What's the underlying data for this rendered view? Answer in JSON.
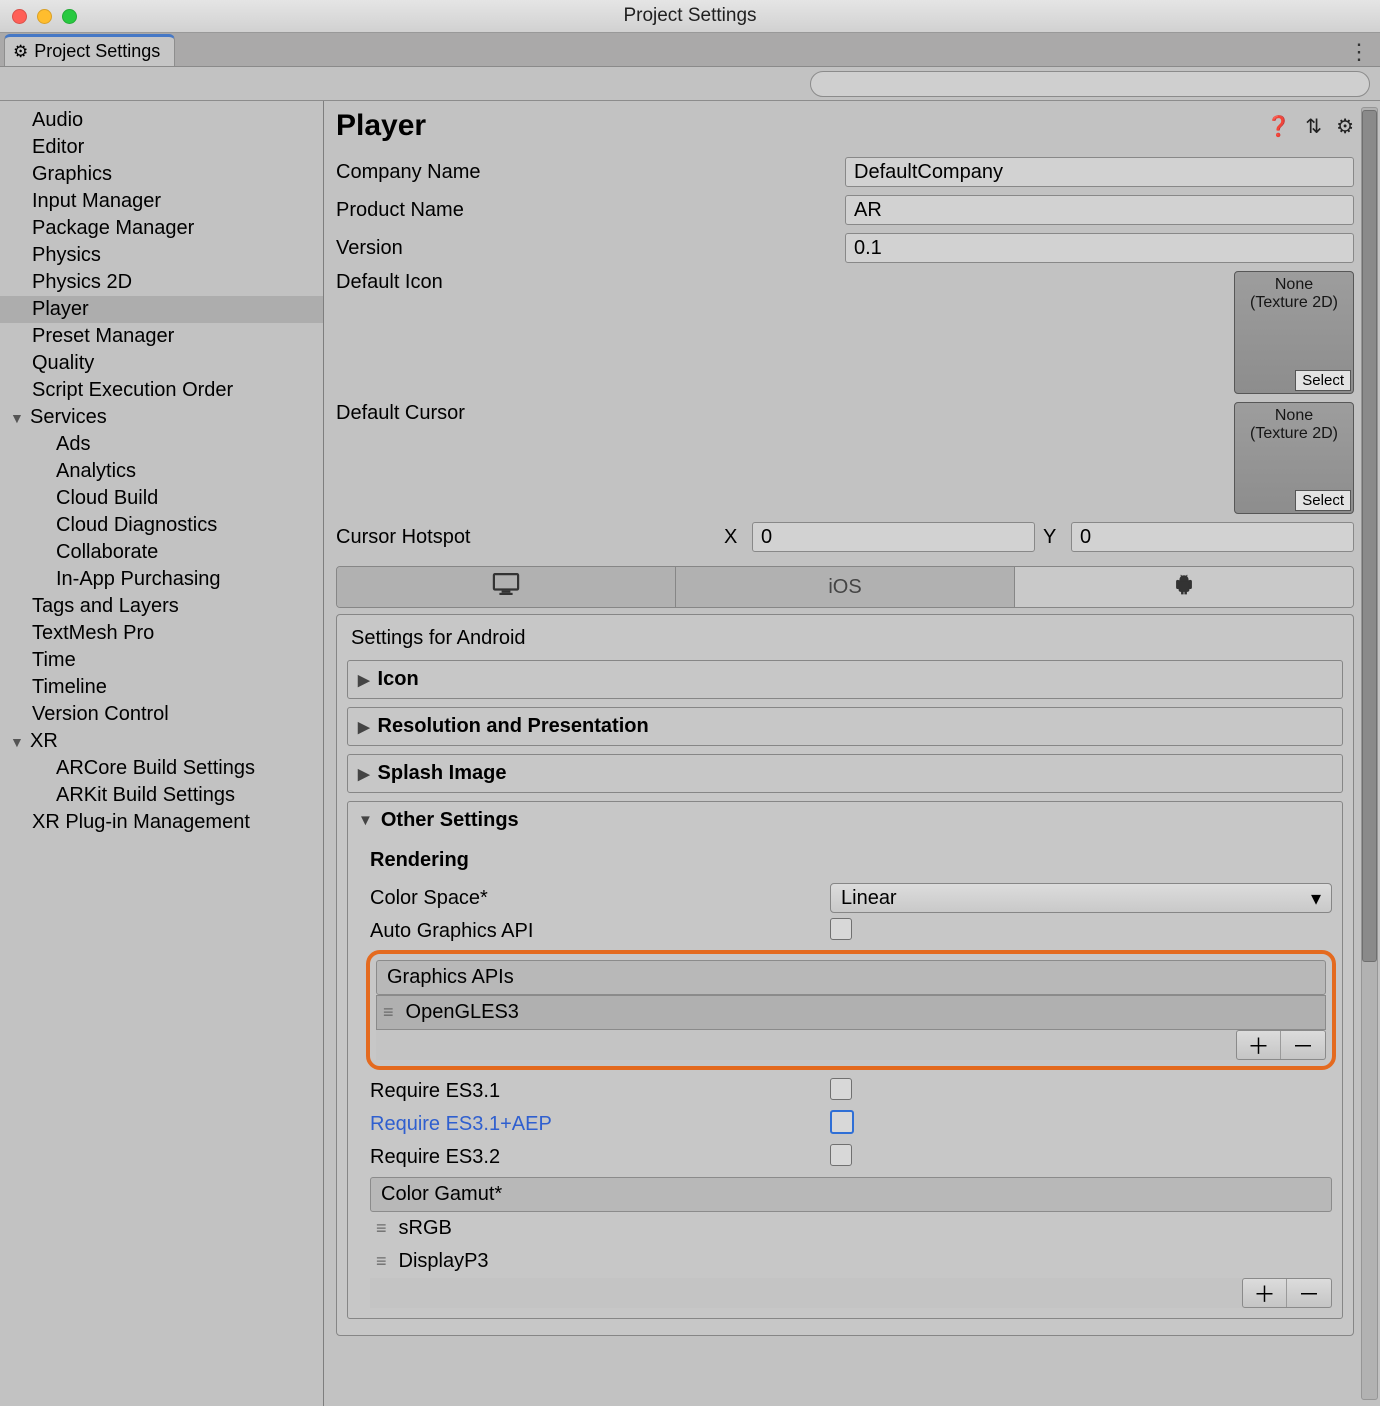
{
  "window": {
    "title": "Project Settings"
  },
  "tab": {
    "label": "Project Settings"
  },
  "search": {
    "placeholder": ""
  },
  "sidebar": {
    "items": [
      {
        "label": "Audio"
      },
      {
        "label": "Editor"
      },
      {
        "label": "Graphics"
      },
      {
        "label": "Input Manager"
      },
      {
        "label": "Package Manager"
      },
      {
        "label": "Physics"
      },
      {
        "label": "Physics 2D"
      },
      {
        "label": "Player",
        "selected": true
      },
      {
        "label": "Preset Manager"
      },
      {
        "label": "Quality"
      },
      {
        "label": "Script Execution Order"
      }
    ],
    "services": {
      "label": "Services",
      "items": [
        {
          "label": "Ads"
        },
        {
          "label": "Analytics"
        },
        {
          "label": "Cloud Build"
        },
        {
          "label": "Cloud Diagnostics"
        },
        {
          "label": "Collaborate"
        },
        {
          "label": "In-App Purchasing"
        }
      ]
    },
    "items2": [
      {
        "label": "Tags and Layers"
      },
      {
        "label": "TextMesh Pro"
      },
      {
        "label": "Time"
      },
      {
        "label": "Timeline"
      },
      {
        "label": "Version Control"
      }
    ],
    "xr": {
      "label": "XR",
      "items": [
        {
          "label": "ARCore Build Settings"
        },
        {
          "label": "ARKit Build Settings"
        }
      ]
    },
    "items3": [
      {
        "label": "XR Plug-in Management"
      }
    ]
  },
  "main": {
    "title": "Player",
    "fields": {
      "companyName": {
        "label": "Company Name",
        "value": "DefaultCompany"
      },
      "productName": {
        "label": "Product Name",
        "value": "AR"
      },
      "version": {
        "label": "Version",
        "value": "0.1"
      },
      "defaultIcon": {
        "label": "Default Icon",
        "none": "None",
        "hint": "(Texture 2D)",
        "select": "Select"
      },
      "defaultCursor": {
        "label": "Default Cursor",
        "none": "None",
        "hint": "(Texture 2D)",
        "select": "Select"
      },
      "cursorHotspot": {
        "label": "Cursor Hotspot",
        "x": "0",
        "y": "0"
      }
    },
    "platformTabs": {
      "ios": "iOS"
    },
    "settingsForLabel": "Settings for Android",
    "foldouts": {
      "icon": "Icon",
      "resolution": "Resolution and Presentation",
      "splash": "Splash Image",
      "other": "Other Settings"
    },
    "rendering": {
      "header": "Rendering",
      "colorSpaceLabel": "Color Space*",
      "colorSpaceValue": "Linear",
      "autoGraphicsLabel": "Auto Graphics API",
      "graphicsApisHeader": "Graphics APIs",
      "graphicsApis": [
        "OpenGLES3"
      ],
      "requireES31": "Require ES3.1",
      "requireES31AEP": "Require ES3.1+AEP",
      "requireES32": "Require ES3.2",
      "colorGamutHeader": "Color Gamut*",
      "colorGamuts": [
        "sRGB",
        "DisplayP3"
      ]
    }
  }
}
